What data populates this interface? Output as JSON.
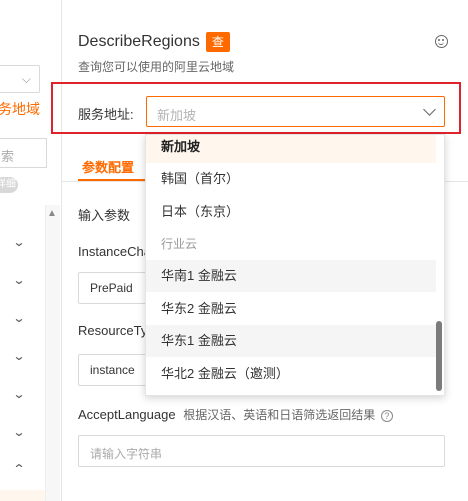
{
  "sidebar": {
    "region_link": "务地域",
    "search_placeholder": "索",
    "tag": "详细"
  },
  "api": {
    "name": "DescribeRegions",
    "badge": "查",
    "description": "查询您可以使用的阿里云地域"
  },
  "endpoint": {
    "label": "服务地址:",
    "selected": "新加坡"
  },
  "tabs": {
    "active": "参数配置"
  },
  "params": {
    "section_label": "输入参数",
    "fields": [
      {
        "label": "InstanceCha",
        "value": "PrePaid"
      },
      {
        "label": "ResourceTyp",
        "value": "instance"
      }
    ],
    "accept_language": {
      "label": "AcceptLanguage",
      "hint": "根据汉语、英语和日语筛选返回结果",
      "placeholder": "请输入字符串"
    }
  },
  "dropdown": {
    "options": [
      "新加坡",
      "韩国（首尔）",
      "日本（东京）",
      "行业云",
      "华南1 金融云",
      "华东2 金融云",
      "华东1 金融云",
      "华北2 金融云（邀测）"
    ]
  },
  "colors": {
    "accent": "#ff6a00",
    "highlight_border": "#e0232b"
  }
}
